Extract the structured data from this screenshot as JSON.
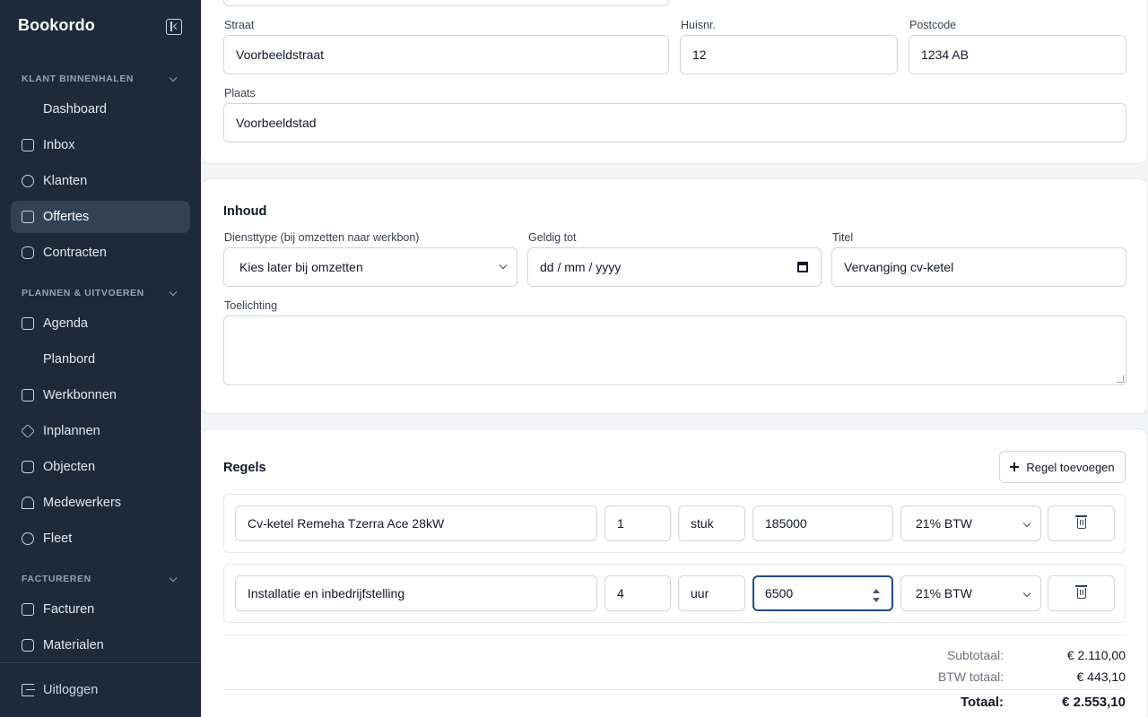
{
  "app": {
    "name": "Bookordo"
  },
  "sidebar": {
    "sections": [
      {
        "title": "KLANT BINNENHALEN",
        "items": [
          {
            "label": "Dashboard",
            "icon": "dashboard-icon"
          },
          {
            "label": "Inbox",
            "icon": "inbox-icon"
          },
          {
            "label": "Klanten",
            "icon": "users-icon"
          },
          {
            "label": "Offertes",
            "icon": "quote-icon",
            "active": true
          },
          {
            "label": "Contracten",
            "icon": "repeat-icon"
          }
        ]
      },
      {
        "title": "PLANNEN & UITVOEREN",
        "items": [
          {
            "label": "Agenda",
            "icon": "calendar-icon"
          },
          {
            "label": "Planbord",
            "icon": "board-icon"
          },
          {
            "label": "Werkbonnen",
            "icon": "clipboard-icon"
          },
          {
            "label": "Inplannen",
            "icon": "send-icon"
          },
          {
            "label": "Objecten",
            "icon": "cube-icon"
          },
          {
            "label": "Medewerkers",
            "icon": "hardhat-icon"
          },
          {
            "label": "Fleet",
            "icon": "location-pin-icon"
          }
        ]
      },
      {
        "title": "FACTUREREN",
        "items": [
          {
            "label": "Facturen",
            "icon": "invoice-icon"
          },
          {
            "label": "Materialen",
            "icon": "package-icon"
          }
        ]
      }
    ],
    "logout": "Uitloggen"
  },
  "address": {
    "street_label": "Straat",
    "street": "Voorbeeldstraat",
    "number_label": "Huisnr.",
    "number": "12",
    "postcode_label": "Postcode",
    "postcode": "1234 AB",
    "city_label": "Plaats",
    "city": "Voorbeeldstad"
  },
  "content": {
    "title": "Inhoud",
    "service_label": "Diensttype (bij omzetten naar werkbon)",
    "service_value": "Kies later bij omzetten",
    "valid_label": "Geldig tot",
    "valid_placeholder": "dd / mm / yyyy",
    "title_label": "Titel",
    "title_value": "Vervanging cv-ketel",
    "note_label": "Toelichting",
    "note_value": ""
  },
  "lines": {
    "title": "Regels",
    "add_label": "Regel toevoegen",
    "rows": [
      {
        "description": "Cv-ketel Remeha Tzerra Ace 28kW",
        "qty": "1",
        "unit": "stuk",
        "price": "185000",
        "vat": "21% BTW"
      },
      {
        "description": "Installatie en inbedrijfstelling",
        "qty": "4",
        "unit": "uur",
        "price": "6500",
        "vat": "21% BTW"
      }
    ]
  },
  "totals": {
    "subtotal_label": "Subtotaal:",
    "subtotal": "€ 2.110,00",
    "vat_label": "BTW totaal:",
    "vat": "€ 443,10",
    "total_label": "Totaal:",
    "total": "€ 2.553,10"
  },
  "colors": {
    "sidebar_bg": "#1e293b",
    "active_item_bg": "#334155",
    "focus_border": "#1e4b8f"
  }
}
